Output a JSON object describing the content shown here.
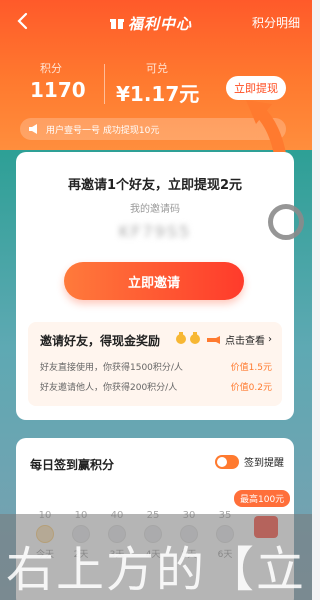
{
  "header": {
    "back_icon": "chevron-left-icon",
    "title_icon": "gift-box-icon",
    "title": "福利中心",
    "points_detail": "积分明细"
  },
  "stats": {
    "points_label": "积分",
    "points_value": "1170",
    "redeemable_label": "可兑",
    "redeemable_value": "¥1.17元",
    "withdraw_button": "立即提现"
  },
  "notice": {
    "icon": "megaphone-icon",
    "text": "用户壹号一号  成功提现10元"
  },
  "invite_card": {
    "title": "再邀请1个好友，立即提现2元",
    "code_label": "我的邀请码",
    "code_value": "KF79S5",
    "invite_button": "立即邀请",
    "reward": {
      "title": "邀请好友，得现金奖励",
      "check_label": "点击查看",
      "rows": [
        {
          "text": "好友直接使用，你获得1500积分/人",
          "value": "价值1.5元"
        },
        {
          "text": "好友邀请他人，你获得200积分/人",
          "value": "价值0.2元"
        }
      ]
    }
  },
  "checkin": {
    "title": "每日签到赢积分",
    "remind_label": "签到提醒",
    "max_badge": "最高100元",
    "days": [
      {
        "points": "10",
        "label": "今天",
        "done": true
      },
      {
        "points": "10",
        "label": "2天",
        "done": false
      },
      {
        "points": "40",
        "label": "3天",
        "done": false
      },
      {
        "points": "25",
        "label": "4天",
        "done": false
      },
      {
        "points": "30",
        "label": "5天",
        "done": false
      },
      {
        "points": "35",
        "label": "6天",
        "done": false
      },
      {
        "points": "",
        "label": "7天",
        "done": false
      }
    ]
  },
  "caption": {
    "text": "右上方的【立"
  },
  "colors": {
    "header_orange": "#ff6a2f",
    "accent_red": "#ff3b2b"
  }
}
